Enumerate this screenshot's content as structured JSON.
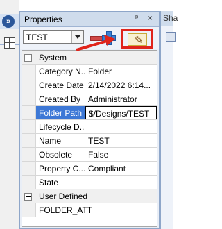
{
  "panel": {
    "title": "Properties",
    "pin_glyph": "ᵖ",
    "close_glyph": "×"
  },
  "right_panel": {
    "title": "Sha"
  },
  "toolbar": {
    "object_selector_value": "TEST"
  },
  "categories": [
    {
      "label": "System",
      "rows": [
        {
          "name": "Category N...",
          "value": "Folder",
          "selected": false
        },
        {
          "name": "Create Date",
          "value": "2/14/2022 6:14...",
          "selected": false
        },
        {
          "name": "Created By",
          "value": "Administrator",
          "selected": false
        },
        {
          "name": "Folder Path",
          "value": "$/Designs/TEST",
          "selected": true
        },
        {
          "name": "Lifecycle D...",
          "value": "",
          "selected": false
        },
        {
          "name": "Name",
          "value": "TEST",
          "selected": false
        },
        {
          "name": "Obsolete",
          "value": "False",
          "selected": false
        },
        {
          "name": "Property C...",
          "value": "Compliant",
          "selected": false
        },
        {
          "name": "State",
          "value": "",
          "selected": false
        }
      ]
    },
    {
      "label": "User Defined",
      "rows": [
        {
          "name": "FOLDER_ATT",
          "value": "",
          "selected": false
        }
      ]
    }
  ],
  "colors": {
    "highlight_box": "#e0241b",
    "selected_row": "#3d78d6",
    "panel_bg": "#e9eef6"
  }
}
